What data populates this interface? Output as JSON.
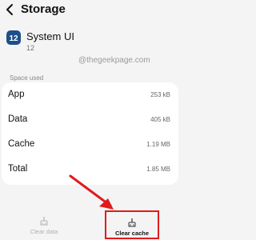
{
  "header": {
    "title": "Storage"
  },
  "app": {
    "name": "System UI",
    "version": "12",
    "icon": "system-ui-app-icon"
  },
  "watermark": "@thegeekpage.com",
  "storage": {
    "section_label": "Space used",
    "rows": [
      {
        "label": "App",
        "value": "253 kB"
      },
      {
        "label": "Data",
        "value": "405 kB"
      },
      {
        "label": "Cache",
        "value": "1.19 MB"
      },
      {
        "label": "Total",
        "value": "1.85 MB"
      }
    ]
  },
  "actions": {
    "clear_data": {
      "label": "Clear data",
      "icon": "clear-data-icon"
    },
    "clear_cache": {
      "label": "Clear cache",
      "icon": "clear-cache-icon"
    }
  },
  "colors": {
    "highlight": "#e01b1b",
    "app_icon": "#1d4f8a",
    "background": "#f4f4f4"
  }
}
